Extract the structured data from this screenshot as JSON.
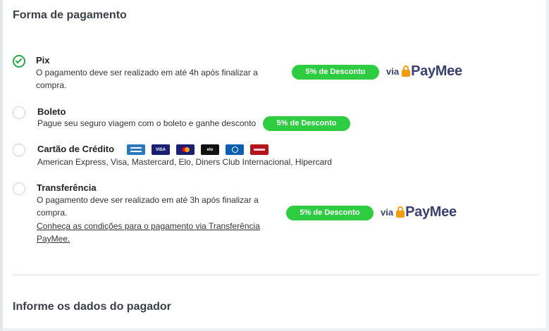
{
  "payment_section": {
    "title": "Forma de pagamento",
    "options": {
      "pix": {
        "label": "Pix",
        "description": "O pagamento deve ser realizado em até 4h após finalizar a compra.",
        "discount": "5% de Desconto",
        "via": "via",
        "brand": "PayMee",
        "selected": true
      },
      "boleto": {
        "label": "Boleto",
        "description": "Pague seu seguro viagem com o boleto e ganhe desconto",
        "discount": "5% de Desconto",
        "selected": false
      },
      "cartao": {
        "label": "Cartão de Crédito",
        "description": "American Express, Visa, Mastercard, Elo, Diners Club Internacional, Hipercard",
        "card_icons": [
          "amex-icon",
          "visa-icon",
          "mastercard-icon",
          "elo-icon",
          "diners-icon",
          "hipercard-icon"
        ],
        "visa_text": "VISA",
        "elo_text": "elo",
        "selected": false
      },
      "transferencia": {
        "label": "Transferência",
        "description": "O pagamento deve ser realizado em até 3h após finalizar a compra.",
        "link": "Conheça as condições para o pagamento via Transferência PayMee.",
        "discount": "5% de Desconto",
        "via": "via",
        "brand": "PayMee",
        "selected": false
      }
    }
  },
  "payer_section": {
    "title": "Informe os dados do pagador"
  },
  "colors": {
    "accent_green": "#2ecc40",
    "check_green": "#2aa84a",
    "paymee_navy": "#3b3f70",
    "paymee_orange": "#f39c12"
  }
}
